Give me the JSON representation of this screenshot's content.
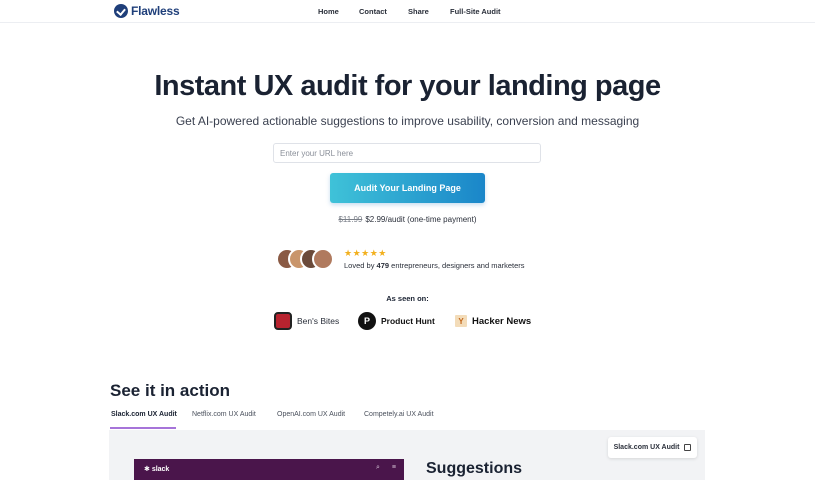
{
  "nav": {
    "brand": "Flawless",
    "links": [
      "Home",
      "Contact",
      "Share",
      "Full-Site Audit"
    ]
  },
  "hero": {
    "title": "Instant UX audit for your landing page",
    "subtitle": "Get AI-powered actionable suggestions to improve usability, conversion and messaging",
    "url_placeholder": "Enter your URL here",
    "cta_label": "Audit Your Landing Page",
    "price_old": "$11.99",
    "price_new": "$2.99/audit (one-time payment)"
  },
  "social_proof": {
    "stars": "★★★★★",
    "loved_prefix": "Loved by",
    "loved_count": "479",
    "loved_suffix": "entrepreneurs, designers and marketers",
    "avatar_colors": [
      "#8a5a44",
      "#c9956b",
      "#6b4a3a",
      "#b07a5e"
    ]
  },
  "press": {
    "heading": "As seen on:",
    "items": [
      {
        "name": "Ben's Bites",
        "icon": "bens-bites-icon"
      },
      {
        "name": "Product Hunt",
        "icon": "product-hunt-icon",
        "glyph": "P"
      },
      {
        "name": "Hacker News",
        "icon": "hacker-news-icon",
        "glyph": "Y"
      }
    ]
  },
  "demo": {
    "section_title": "See it in action",
    "tabs": [
      "Slack.com UX Audit",
      "Netflix.com UX Audit",
      "OpenAI.com UX Audit",
      "Competely.ai UX Audit"
    ],
    "active_tab": "Slack.com UX Audit",
    "chip_label": "Slack.com UX Audit",
    "preview_logo": "slack",
    "suggestions_heading": "Suggestions"
  },
  "colors": {
    "brand": "#1f3f7a",
    "cta_gradient_start": "#3fc2d8",
    "cta_gradient_end": "#1a86c9",
    "star": "#f2b01e",
    "tab_active": "#a674d9",
    "slack_purple": "#4a154b"
  }
}
